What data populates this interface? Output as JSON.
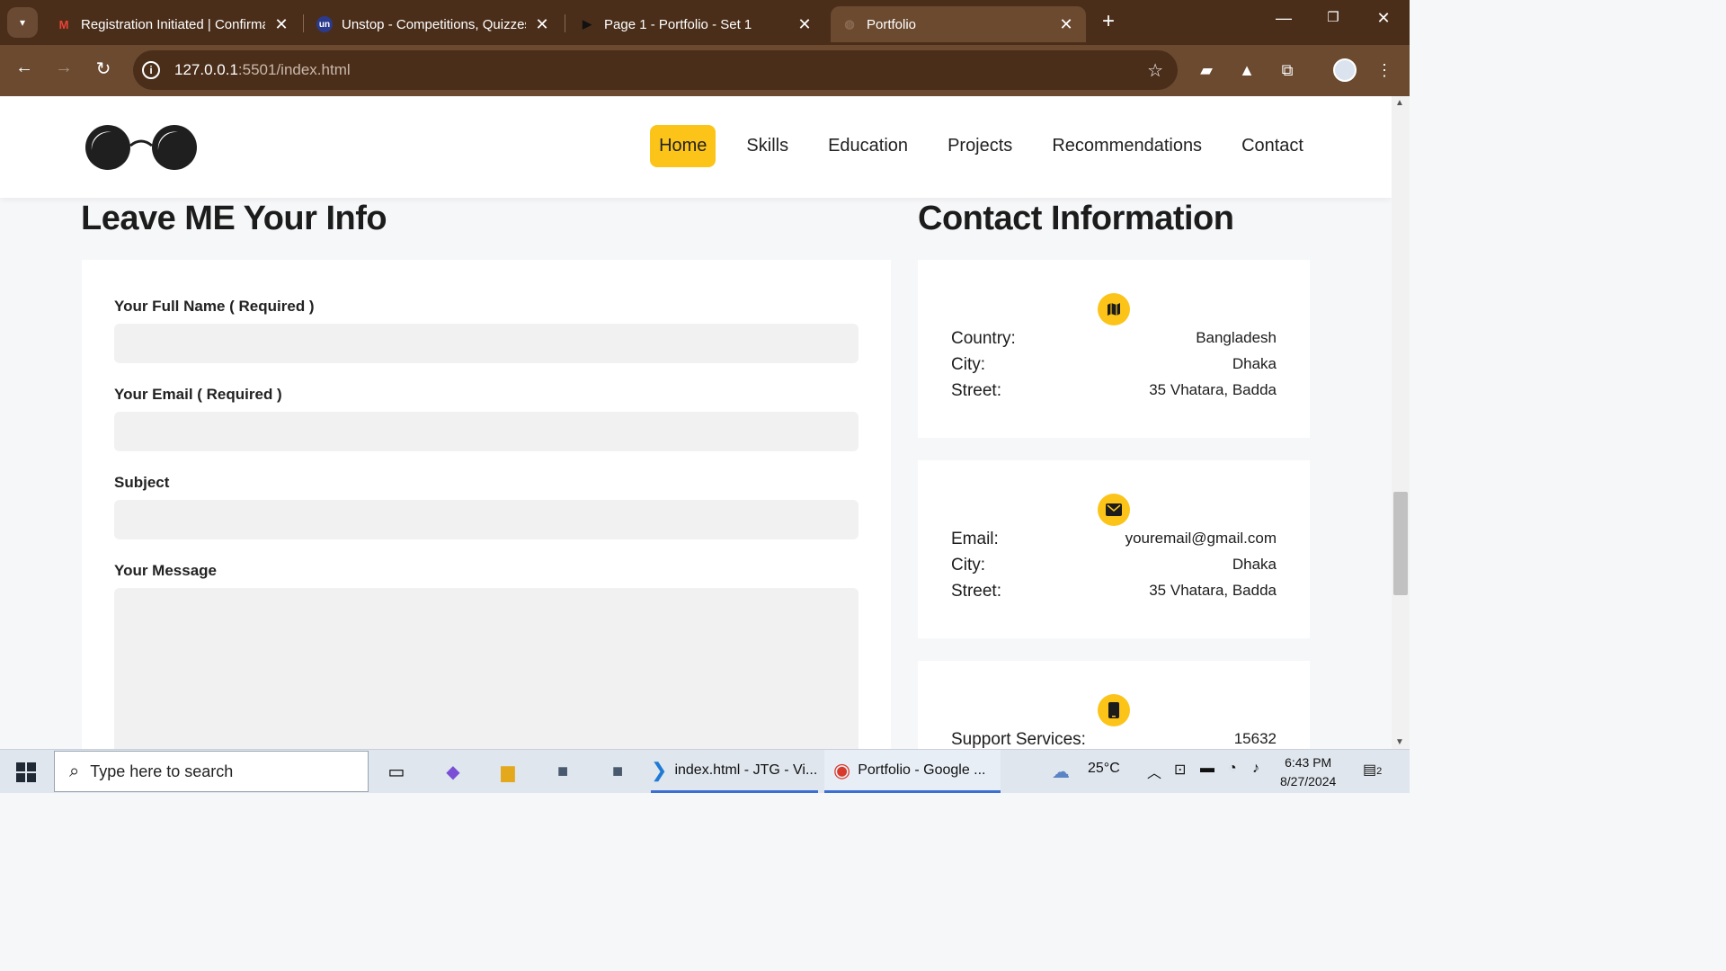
{
  "browser": {
    "tabs": [
      {
        "title": "Registration Initiated | Confirma",
        "favicon": "gmail-icon"
      },
      {
        "title": "Unstop - Competitions, Quizzes",
        "favicon": "unstop-icon"
      },
      {
        "title": "Page 1 - Portfolio - Set 1",
        "favicon": "play-icon"
      },
      {
        "title": "Portfolio",
        "favicon": "globe-icon"
      }
    ],
    "url_host": "127.0.0.1",
    "url_rest": ":5501/index.html"
  },
  "site": {
    "nav": [
      "Home",
      "Skills",
      "Education",
      "Projects",
      "Recommendations",
      "Contact"
    ],
    "active_nav": "Home",
    "accent": "#fcc419"
  },
  "form": {
    "heading": "Leave ME Your Info",
    "labels": {
      "name": "Your Full Name ( Required )",
      "email": "Your Email ( Required )",
      "subject": "Subject",
      "message": "Your Message"
    }
  },
  "contact": {
    "heading": "Contact Information",
    "cards": [
      {
        "icon": "map-icon",
        "rows": [
          {
            "k": "Country:",
            "v": "Bangladesh"
          },
          {
            "k": "City:",
            "v": "Dhaka"
          },
          {
            "k": "Street:",
            "v": "35 Vhatara, Badda"
          }
        ]
      },
      {
        "icon": "envelope-icon",
        "rows": [
          {
            "k": "Email:",
            "v": "youremail@gmail.com"
          },
          {
            "k": "City:",
            "v": "Dhaka"
          },
          {
            "k": "Street:",
            "v": "35 Vhatara, Badda"
          }
        ]
      },
      {
        "icon": "phone-icon",
        "rows": [
          {
            "k": "Support Services:",
            "v": "15632"
          }
        ]
      }
    ]
  },
  "taskbar": {
    "search_placeholder": "Type here to search",
    "tasks": [
      "index.html - JTG - Vi...",
      "Portfolio - Google ..."
    ],
    "weather": "25°C",
    "time": "6:43 PM",
    "date": "8/27/2024",
    "notifications": "2"
  }
}
